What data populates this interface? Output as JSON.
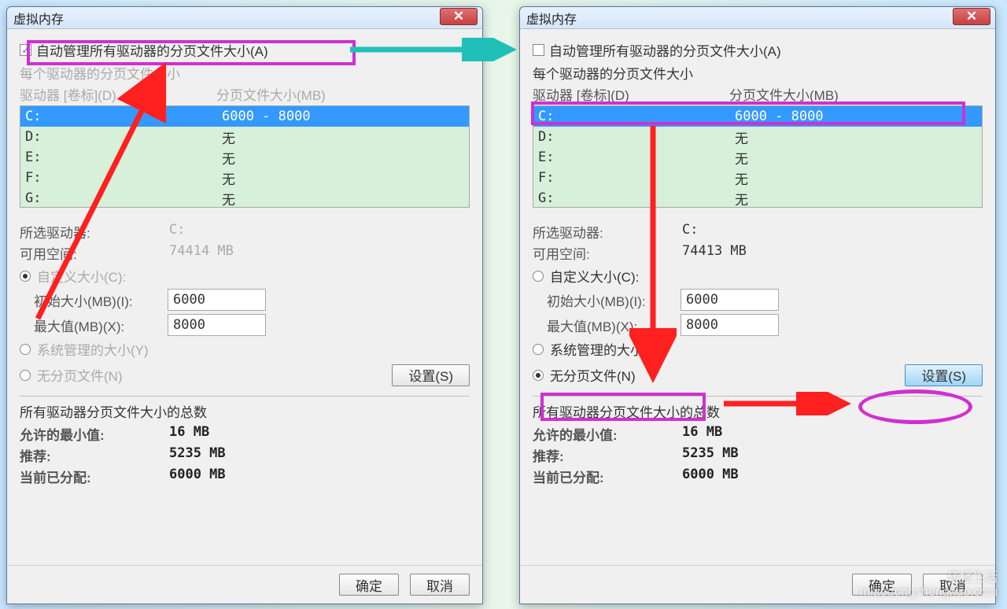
{
  "title": "虚拟内存",
  "auto_manage_label": "自动管理所有驱动器的分页文件大小(A)",
  "per_drive_label": "每个驱动器的分页文件大小",
  "col_drive": "驱动器 [卷标](D)",
  "col_paging": "分页文件大小(MB)",
  "drives": [
    {
      "name": "C:",
      "value": "6000 - 8000"
    },
    {
      "name": "D:",
      "value": "无"
    },
    {
      "name": "E:",
      "value": "无"
    },
    {
      "name": "F:",
      "value": "无"
    },
    {
      "name": "G:",
      "value": "无"
    }
  ],
  "selected_drive_label": "所选驱动器:",
  "selected_drive_value": "C:",
  "avail_label": "可用空间:",
  "left_avail_value": "74414 MB",
  "right_avail_value": "74413 MB",
  "custom_size_label": "自定义大小(C):",
  "initial_size_label": "初始大小(MB)(I):",
  "initial_size_value": "6000",
  "max_size_label": "最大值(MB)(X):",
  "max_size_value": "8000",
  "system_managed_label": "系统管理的大小(Y)",
  "no_paging_label": "无分页文件(N)",
  "set_button": "设置(S)",
  "totals_heading": "所有驱动器分页文件大小的总数",
  "min_label": "允许的最小值:",
  "min_value": "16 MB",
  "rec_label": "推荐:",
  "rec_value": "5235 MB",
  "alloc_label": "当前已分配:",
  "alloc_value": "6000 MB",
  "ok_button": "确定",
  "cancel_button": "取消",
  "watermark": "转播生活\nmiaodongshenghuo.com"
}
